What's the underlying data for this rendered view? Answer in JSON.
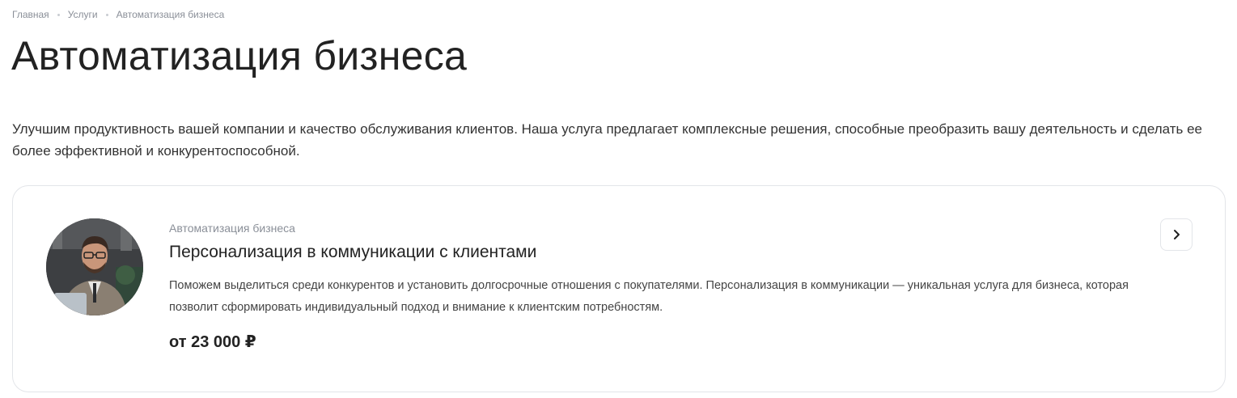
{
  "breadcrumb": {
    "items": [
      "Главная",
      "Услуги",
      "Автоматизация бизнеса"
    ]
  },
  "page": {
    "title": "Автоматизация бизнеса",
    "intro": "Улучшим продуктивность вашей компании и качество обслуживания клиентов. Наша услуга предлагает комплексные решения, способные преобразить вашу деятельность и сделать ее более эффективной и конкурентоспособной."
  },
  "card": {
    "category": "Автоматизация бизнеса",
    "title": "Персонализация в коммуникации с клиентами",
    "description": "Поможем выделиться среди конкурентов и установить долгосрочные отношения с покупателями. Персонализация в коммуникации — уникальная услуга для бизнеса, которая позволит сформировать индивидуальный подход и внимание к клиентским потребностям.",
    "price": "от 23 000 ₽",
    "arrow_icon": "chevron-right-icon"
  }
}
